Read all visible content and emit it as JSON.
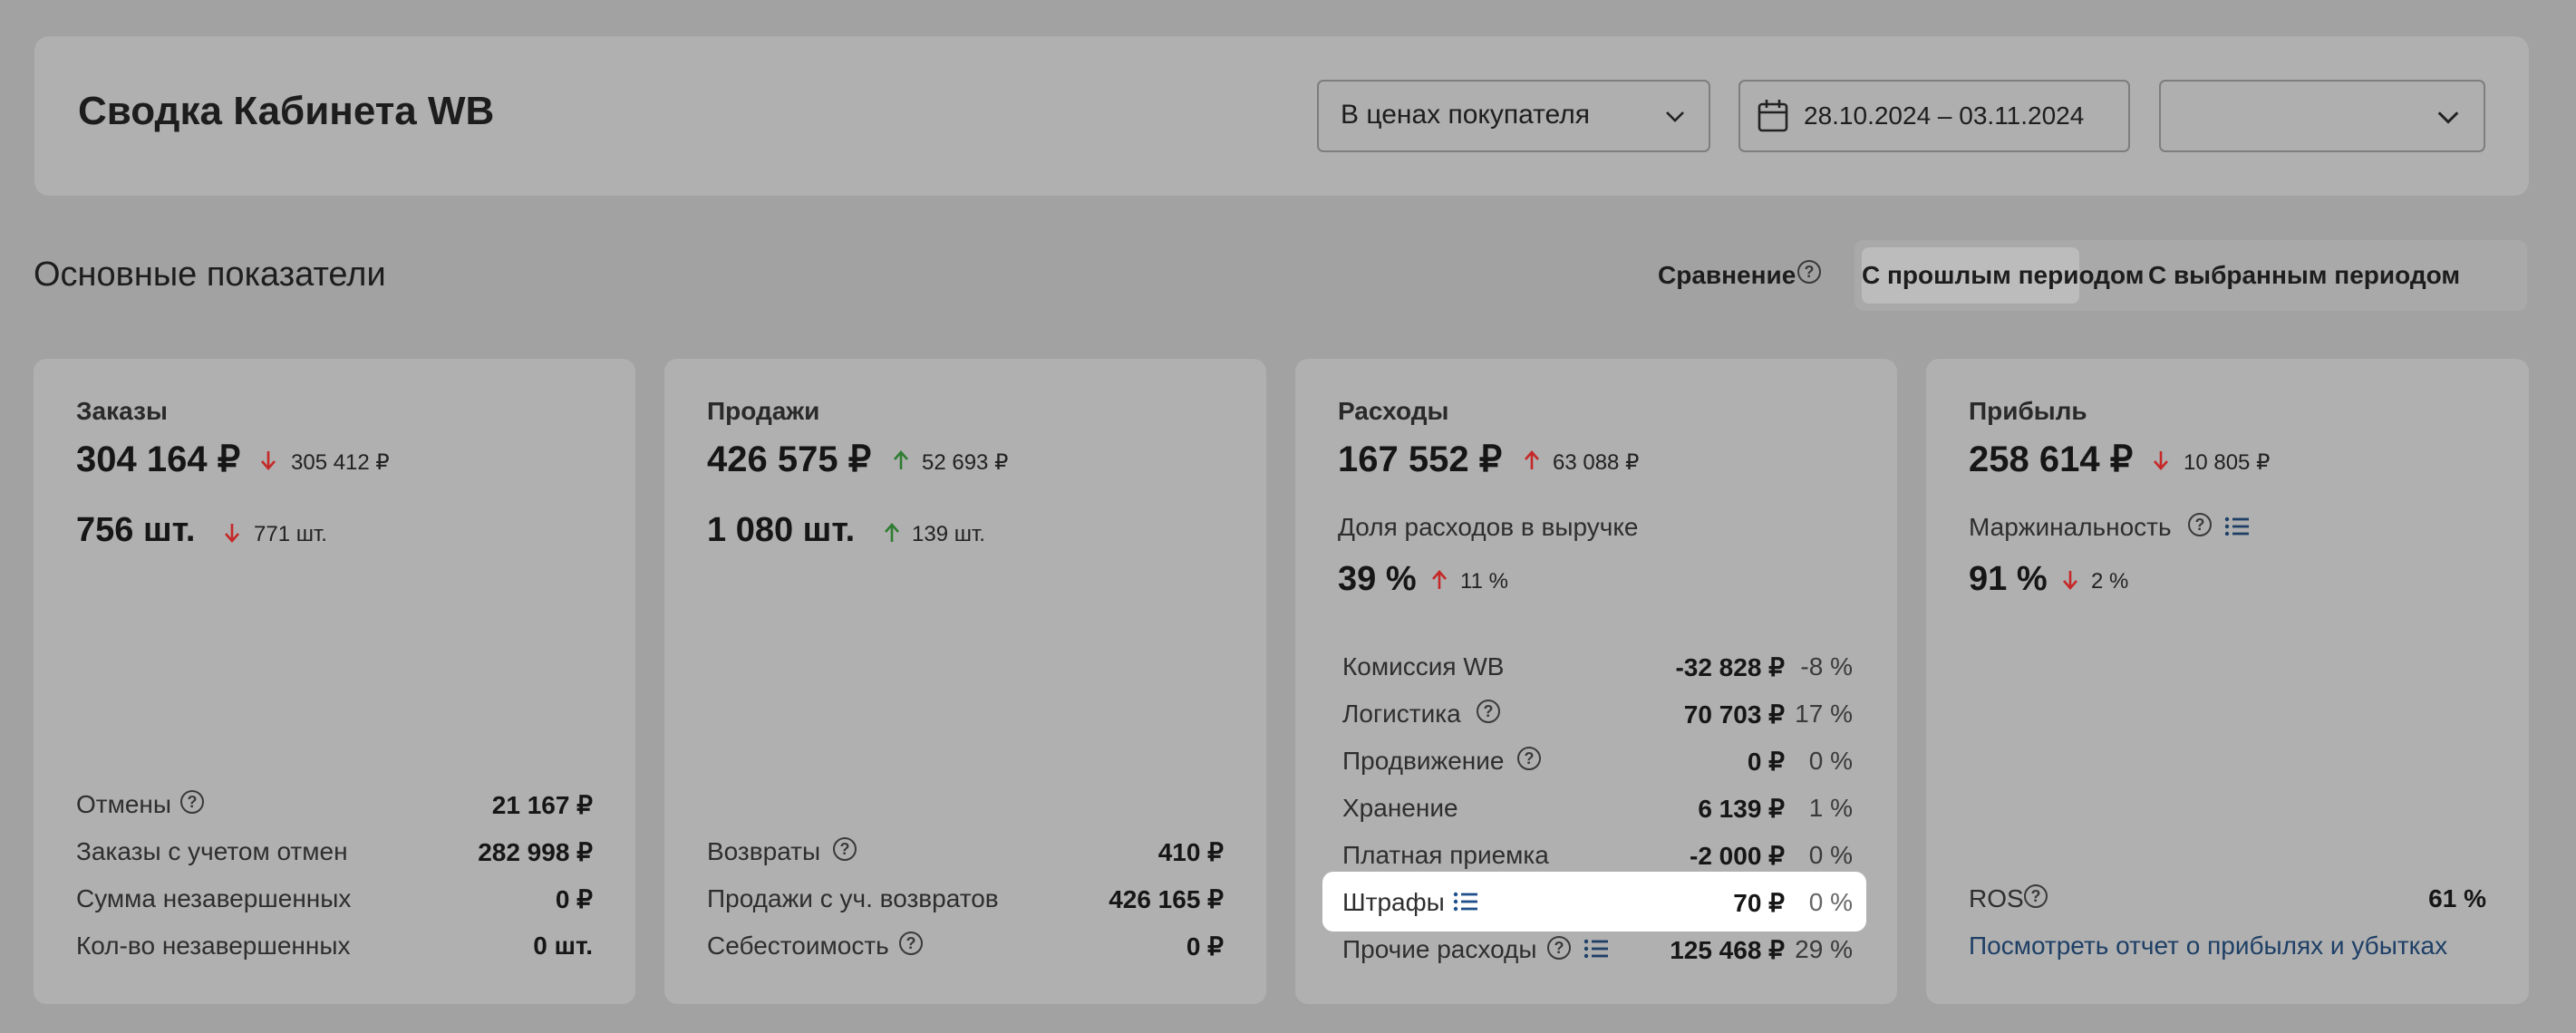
{
  "header": {
    "title": "Сводка Кабинета WB",
    "price_mode": "В ценах покупателя",
    "date_range": "28.10.2024 – 03.11.2024",
    "extra_select": ""
  },
  "section": {
    "title": "Основные показатели",
    "compare_label": "Сравнение",
    "segments": [
      "С прошлым периодом",
      "С выбранным периодом"
    ],
    "active_segment": "С прошлым периодом"
  },
  "colors": {
    "up": "#2e7d32",
    "down": "#c62828",
    "link": "#1e3f66",
    "highlight": "#ffffff"
  },
  "cards": {
    "orders": {
      "title": "Заказы",
      "amount": "304 164 ₽",
      "amount_delta": "305 412 ₽",
      "amount_trend": "down",
      "count": "756 шт.",
      "count_delta": "771 шт.",
      "count_trend": "down",
      "rows": [
        {
          "label": "Отмены",
          "value": "21 167 ₽",
          "help": true
        },
        {
          "label": "Заказы с учетом отмен",
          "value": "282 998 ₽"
        },
        {
          "label": "Сумма незавершенных",
          "value": "0 ₽"
        },
        {
          "label": "Кол-во незавершенных",
          "value": "0 шт."
        }
      ]
    },
    "sales": {
      "title": "Продажи",
      "amount": "426 575 ₽",
      "amount_delta": "52 693 ₽",
      "amount_trend": "up",
      "count": "1 080 шт.",
      "count_delta": "139 шт.",
      "count_trend": "up",
      "rows": [
        {
          "label": "Возвраты",
          "value": "410 ₽",
          "help": true
        },
        {
          "label": "Продажи с уч. возвратов",
          "value": "426 165 ₽"
        },
        {
          "label": "Себестоимость",
          "value": "0 ₽",
          "help": true
        }
      ]
    },
    "expenses": {
      "title": "Расходы",
      "amount": "167 552 ₽",
      "amount_delta": "63 088 ₽",
      "amount_trend": "up",
      "share_label": "Доля расходов в выручке",
      "share": "39 %",
      "share_delta": "11 %",
      "share_trend": "up",
      "rows": [
        {
          "label": "Комиссия WB",
          "value": "-32 828 ₽",
          "pct": "-8 %"
        },
        {
          "label": "Логистика",
          "value": "70 703 ₽",
          "pct": "17 %",
          "help": true
        },
        {
          "label": "Продвижение",
          "value": "0 ₽",
          "pct": "0 %",
          "help": true
        },
        {
          "label": "Хранение",
          "value": "6 139 ₽",
          "pct": "1 %"
        },
        {
          "label": "Платная приемка",
          "value": "-2 000 ₽",
          "pct": "0 %"
        },
        {
          "label": "Штрафы",
          "value": "70 ₽",
          "pct": "0 %",
          "list": true,
          "highlighted": true
        },
        {
          "label": "Прочие расходы",
          "value": "125 468 ₽",
          "pct": "29 %",
          "help": true,
          "list": true
        }
      ]
    },
    "profit": {
      "title": "Прибыль",
      "amount": "258 614 ₽",
      "amount_delta": "10 805 ₽",
      "amount_trend": "down",
      "margin_label": "Маржинальность",
      "margin": "91 %",
      "margin_delta": "2 %",
      "margin_trend": "down",
      "ros_label": "ROS",
      "ros_value": "61 %",
      "report_link": "Посмотреть отчет о прибылях и убытках"
    }
  }
}
